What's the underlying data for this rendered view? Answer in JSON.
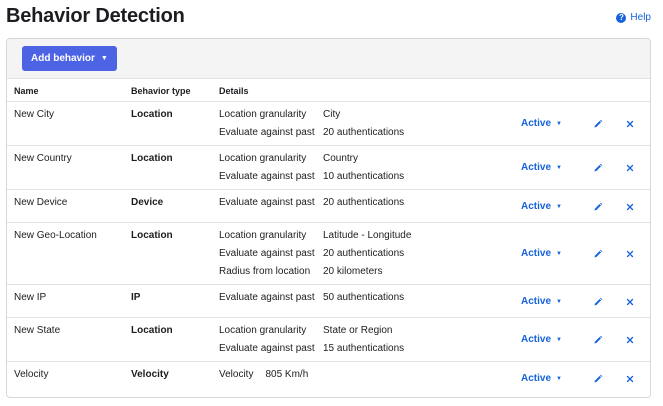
{
  "page": {
    "title": "Behavior Detection",
    "help_label": "Help"
  },
  "toolbar": {
    "add_label": "Add behavior"
  },
  "columns": {
    "name": "Name",
    "type": "Behavior type",
    "details": "Details"
  },
  "rows": [
    {
      "name": "New City",
      "type": "Location",
      "status": "Active",
      "details": [
        {
          "label": "Location granularity",
          "value": "City"
        },
        {
          "label": "Evaluate against past",
          "value": "20 authentications"
        }
      ]
    },
    {
      "name": "New Country",
      "type": "Location",
      "status": "Active",
      "details": [
        {
          "label": "Location granularity",
          "value": "Country"
        },
        {
          "label": "Evaluate against past",
          "value": "10 authentications"
        }
      ]
    },
    {
      "name": "New Device",
      "type": "Device",
      "status": "Active",
      "details": [
        {
          "label": "Evaluate against past",
          "value": "20 authentications"
        }
      ]
    },
    {
      "name": "New Geo-Location",
      "type": "Location",
      "status": "Active",
      "details": [
        {
          "label": "Location granularity",
          "value": "Latitude - Longitude"
        },
        {
          "label": "Evaluate against past",
          "value": "20 authentications"
        },
        {
          "label": "Radius from location",
          "value": "20 kilometers"
        }
      ]
    },
    {
      "name": "New IP",
      "type": "IP",
      "status": "Active",
      "details": [
        {
          "label": "Evaluate against past",
          "value": "50 authentications"
        }
      ]
    },
    {
      "name": "New State",
      "type": "Location",
      "status": "Active",
      "details": [
        {
          "label": "Location granularity",
          "value": "State or Region"
        },
        {
          "label": "Evaluate against past",
          "value": "15 authentications"
        }
      ]
    },
    {
      "name": "Velocity",
      "type": "Velocity",
      "status": "Active",
      "details": [
        {
          "label": "Velocity",
          "value": "805 Km/h"
        }
      ]
    }
  ],
  "icons": {
    "help": "help-circle-icon",
    "edit": "pencil-icon",
    "delete": "close-icon",
    "status_caret": "caret-down-icon"
  },
  "colors": {
    "accent": "#1662dd",
    "button": "#4c64e4"
  }
}
